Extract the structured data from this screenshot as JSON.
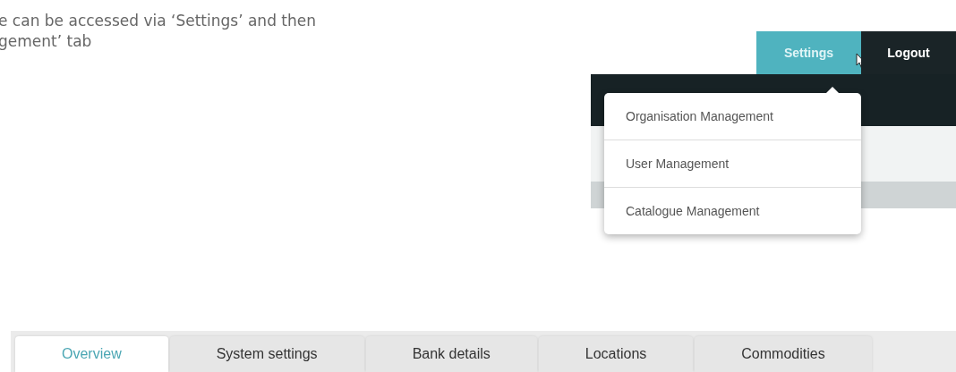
{
  "caption": {
    "lines": [
      "e can be accessed via ‘Settings’ and then",
      "gement’ tab"
    ]
  },
  "navbar": {
    "items": [
      {
        "label": "Settings",
        "selected": true
      },
      {
        "label": "Logout",
        "selected": false
      }
    ]
  },
  "dropdown": {
    "items": [
      {
        "label": "Organisation Management"
      },
      {
        "label": "User Management"
      },
      {
        "label": "Catalogue Management"
      }
    ]
  },
  "tabs": [
    {
      "label": "Overview",
      "selected": true
    },
    {
      "label": "System settings",
      "selected": false
    },
    {
      "label": "Bank details",
      "selected": false
    },
    {
      "label": "Locations",
      "selected": false
    },
    {
      "label": "Commodities",
      "selected": false
    }
  ]
}
